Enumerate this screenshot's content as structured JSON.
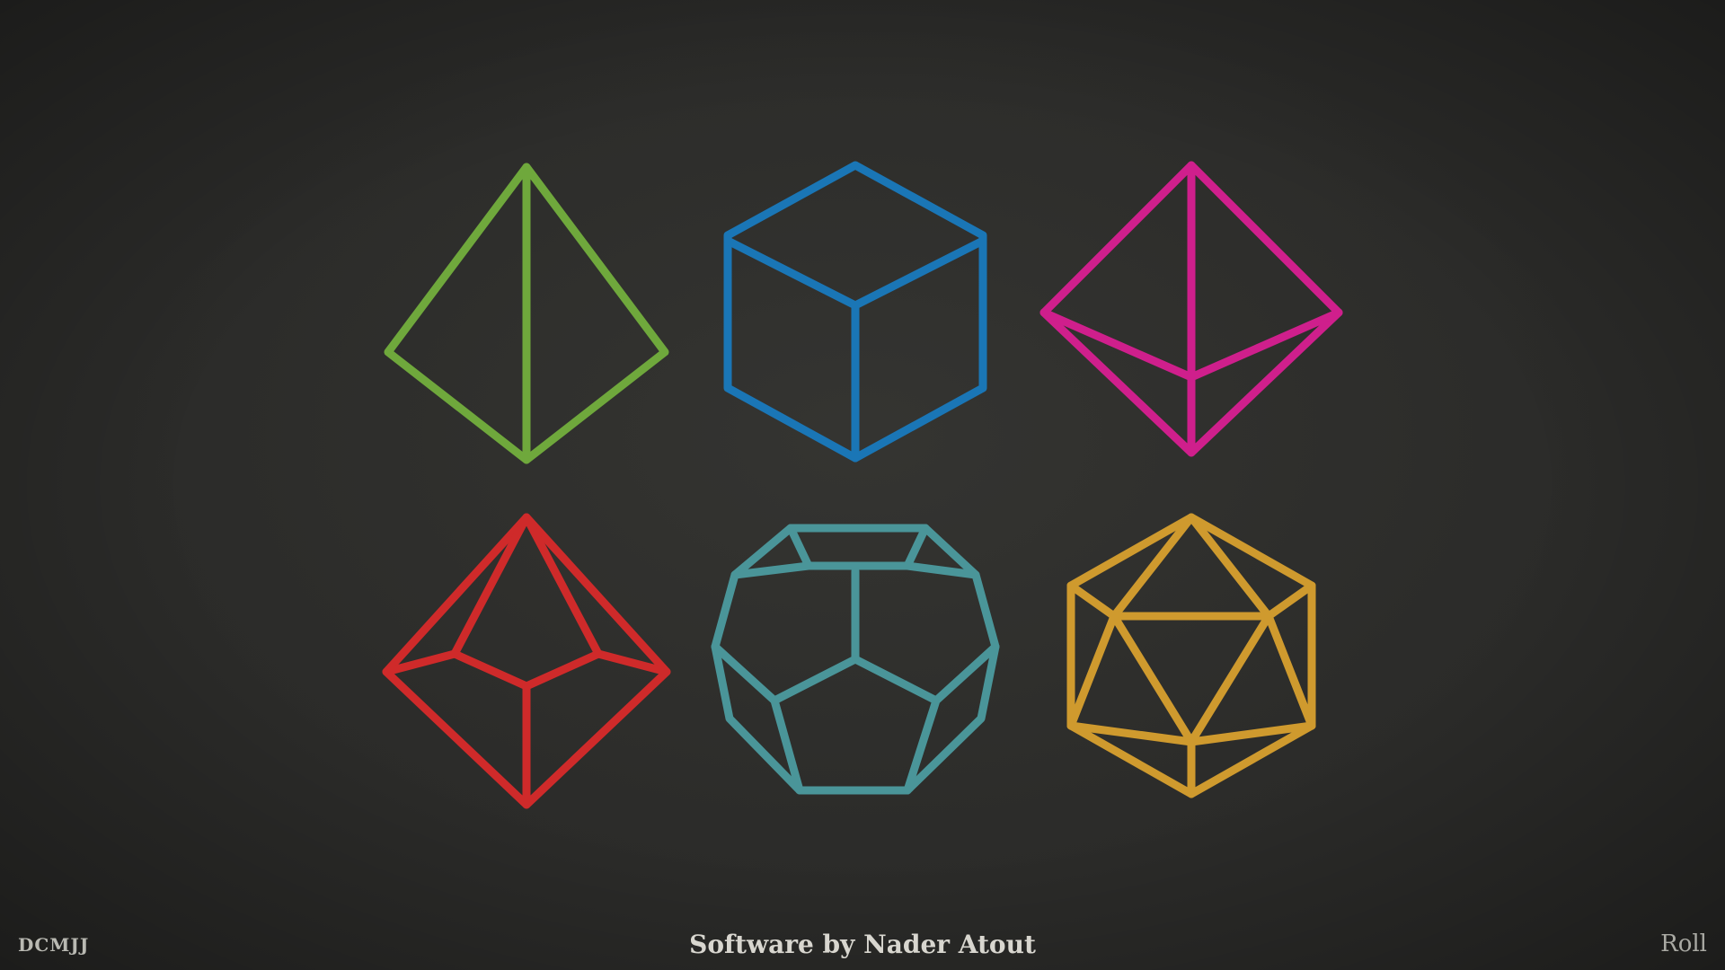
{
  "footer": {
    "logo_text": "DCMJJ",
    "credit": "Software by Nader Atout",
    "roll_label": "Roll"
  },
  "dice": [
    {
      "type": "d4",
      "icon": "tetrahedron-icon",
      "color": "#6fa83c"
    },
    {
      "type": "d6",
      "icon": "cube-icon",
      "color": "#1a76b6"
    },
    {
      "type": "d8",
      "icon": "octahedron-icon",
      "color": "#cf1f8c"
    },
    {
      "type": "d10",
      "icon": "trapezohedron-icon",
      "color": "#cf2a2a"
    },
    {
      "type": "d12",
      "icon": "dodecahedron-icon",
      "color": "#4a9599"
    },
    {
      "type": "d20",
      "icon": "icosahedron-icon",
      "color": "#cf9a2e"
    }
  ]
}
